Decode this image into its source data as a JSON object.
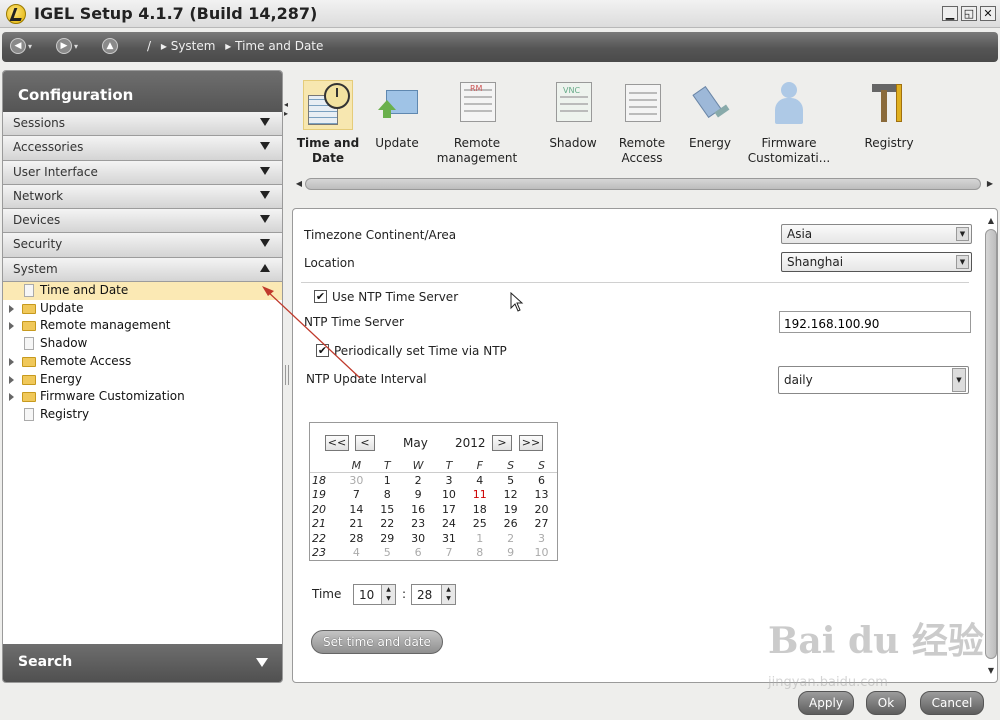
{
  "window": {
    "title": "IGEL Setup 4.1.7 (Build 14,287)",
    "min_label": "▁",
    "max_label": "◱",
    "close_label": "✕"
  },
  "nav": {
    "back_icon": "◀",
    "forward_icon": "▶",
    "up_icon": "▲",
    "dropdown_icon": "▾",
    "breadcrumb": [
      "/",
      "▸ System",
      "▸ Time and Date"
    ]
  },
  "sidebar": {
    "header": "Configuration",
    "categories": [
      {
        "label": "Sessions",
        "expanded": false
      },
      {
        "label": "Accessories",
        "expanded": false
      },
      {
        "label": "User Interface",
        "expanded": false
      },
      {
        "label": "Network",
        "expanded": false
      },
      {
        "label": "Devices",
        "expanded": false
      },
      {
        "label": "Security",
        "expanded": false
      },
      {
        "label": "System",
        "expanded": true
      }
    ],
    "tree": [
      {
        "label": "Time and Date",
        "selected": true,
        "expandable": false,
        "icon": "page"
      },
      {
        "label": "Update",
        "selected": false,
        "expandable": true,
        "icon": "folder"
      },
      {
        "label": "Remote management",
        "selected": false,
        "expandable": true,
        "icon": "folder"
      },
      {
        "label": "Shadow",
        "selected": false,
        "expandable": false,
        "icon": "page"
      },
      {
        "label": "Remote Access",
        "selected": false,
        "expandable": true,
        "icon": "folder"
      },
      {
        "label": "Energy",
        "selected": false,
        "expandable": true,
        "icon": "folder"
      },
      {
        "label": "Firmware Customization",
        "selected": false,
        "expandable": true,
        "icon": "folder"
      },
      {
        "label": "Registry",
        "selected": false,
        "expandable": false,
        "icon": "page"
      }
    ],
    "search_label": "Search"
  },
  "toolbar": {
    "items": [
      {
        "label": "Time and\nDate",
        "icon": "clock-calendar-icon",
        "selected": true
      },
      {
        "label": "Update",
        "icon": "update-icon",
        "selected": false
      },
      {
        "label": "Remote\nmanagement",
        "icon": "remote-management-icon",
        "badge": "RM",
        "selected": false
      },
      {
        "label": "Shadow",
        "icon": "vnc-shadow-icon",
        "badge": "VNC",
        "selected": false
      },
      {
        "label": "Remote\nAccess",
        "icon": "remote-access-icon",
        "selected": false
      },
      {
        "label": "Energy",
        "icon": "energy-plug-icon",
        "selected": false
      },
      {
        "label": "Firmware\nCustomizati...",
        "icon": "firmware-user-icon",
        "selected": false
      },
      {
        "label": "Registry",
        "icon": "registry-tools-icon",
        "selected": false
      }
    ]
  },
  "form": {
    "timezone_label": "Timezone Continent/Area",
    "timezone_value": "Asia",
    "location_label": "Location",
    "location_value": "Shanghai",
    "use_ntp_label": "Use NTP Time Server",
    "use_ntp_checked": true,
    "ntp_server_label": "NTP Time Server",
    "ntp_server_value": "192.168.100.90",
    "periodic_label": "Periodically set Time via NTP",
    "periodic_checked": true,
    "interval_label": "NTP Update Interval",
    "interval_value": "daily",
    "time_label": "Time",
    "hour": "10",
    "minute": "28",
    "time_separator": ":",
    "set_button": "Set time and date"
  },
  "calendar": {
    "prev_year": "<<",
    "prev_month": "<",
    "next_month": ">",
    "next_year": ">>",
    "month": "May",
    "year": "2012",
    "weekdays": [
      "M",
      "T",
      "W",
      "T",
      "F",
      "S",
      "S"
    ],
    "weeks": [
      {
        "wk": "18",
        "days": [
          {
            "d": "30",
            "other": true
          },
          {
            "d": "1"
          },
          {
            "d": "2"
          },
          {
            "d": "3"
          },
          {
            "d": "4"
          },
          {
            "d": "5"
          },
          {
            "d": "6"
          }
        ]
      },
      {
        "wk": "19",
        "days": [
          {
            "d": "7"
          },
          {
            "d": "8"
          },
          {
            "d": "9"
          },
          {
            "d": "10"
          },
          {
            "d": "11",
            "today": true
          },
          {
            "d": "12"
          },
          {
            "d": "13"
          }
        ]
      },
      {
        "wk": "20",
        "days": [
          {
            "d": "14"
          },
          {
            "d": "15"
          },
          {
            "d": "16"
          },
          {
            "d": "17"
          },
          {
            "d": "18"
          },
          {
            "d": "19"
          },
          {
            "d": "20"
          }
        ]
      },
      {
        "wk": "21",
        "days": [
          {
            "d": "21"
          },
          {
            "d": "22"
          },
          {
            "d": "23"
          },
          {
            "d": "24"
          },
          {
            "d": "25"
          },
          {
            "d": "26"
          },
          {
            "d": "27"
          }
        ]
      },
      {
        "wk": "22",
        "days": [
          {
            "d": "28"
          },
          {
            "d": "29"
          },
          {
            "d": "30"
          },
          {
            "d": "31"
          },
          {
            "d": "1",
            "other": true
          },
          {
            "d": "2",
            "other": true
          },
          {
            "d": "3",
            "other": true
          }
        ]
      },
      {
        "wk": "23",
        "days": [
          {
            "d": "4",
            "other": true
          },
          {
            "d": "5",
            "other": true
          },
          {
            "d": "6",
            "other": true
          },
          {
            "d": "7",
            "other": true
          },
          {
            "d": "8",
            "other": true
          },
          {
            "d": "9",
            "other": true
          },
          {
            "d": "10",
            "other": true
          }
        ]
      }
    ]
  },
  "buttons": {
    "apply": "Apply",
    "ok": "Ok",
    "cancel": "Cancel"
  },
  "watermark": {
    "main": "Bai du 经验",
    "sub": "jingyan.baidu.com"
  },
  "colors": {
    "selected_bg": "#fbe9b4",
    "annotation_arrow": "#c0392b",
    "today": "#cc0000"
  }
}
